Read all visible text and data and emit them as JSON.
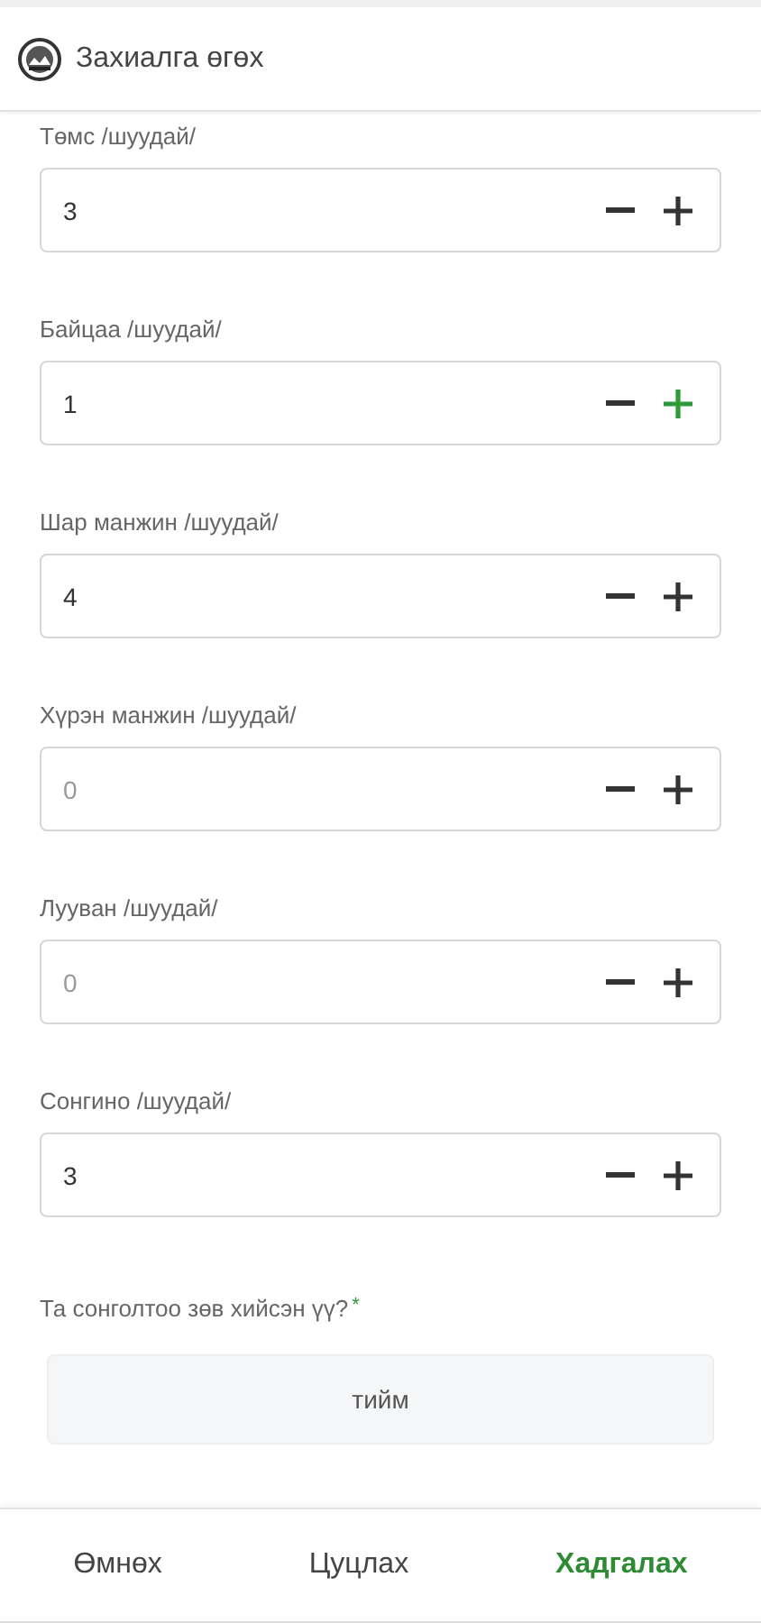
{
  "header": {
    "title": "Захиалга өгөх"
  },
  "items": [
    {
      "label": "Төмс /шуудай/",
      "value": "3",
      "plus_highlighted": false
    },
    {
      "label": "Байцаа /шуудай/",
      "value": "1",
      "plus_highlighted": true
    },
    {
      "label": "Шар манжин /шуудай/",
      "value": "4",
      "plus_highlighted": false
    },
    {
      "label": "Хүрэн манжин /шуудай/",
      "placeholder": "0",
      "plus_highlighted": false
    },
    {
      "label": "Лууван /шуудай/",
      "placeholder": "0",
      "plus_highlighted": false
    },
    {
      "label": "Сонгино /шуудай/",
      "value": "3",
      "plus_highlighted": false
    }
  ],
  "question": {
    "label": "Та сонголтоо зөв хийсэн үү?",
    "required": true,
    "required_mark": "*",
    "option": "тийм"
  },
  "footer": [
    {
      "label": "Өмнөх",
      "kind": "normal"
    },
    {
      "label": "Цуцлах",
      "kind": "normal"
    },
    {
      "label": "Хадгалах",
      "kind": "primary"
    }
  ]
}
